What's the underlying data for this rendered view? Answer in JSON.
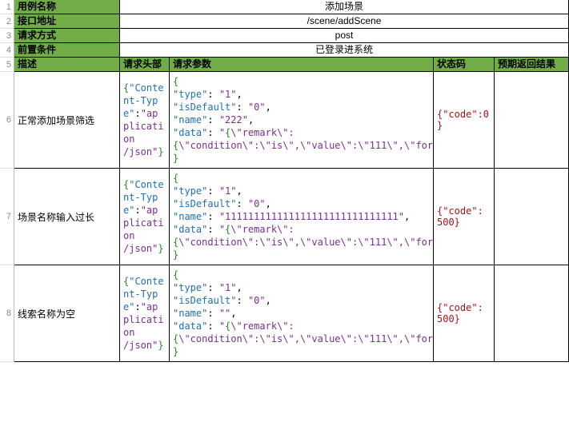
{
  "header_rows": [
    {
      "num": "1",
      "label": "用例名称",
      "value": "添加场景"
    },
    {
      "num": "2",
      "label": "接口地址",
      "value": "/scene/addScene"
    },
    {
      "num": "3",
      "label": "请求方式",
      "value": "post"
    },
    {
      "num": "4",
      "label": "前置条件",
      "value": "已登录进系统"
    }
  ],
  "col_row_num": "5",
  "columns": {
    "desc": "描述",
    "reqhdr": "请求头部",
    "reqparam": "请求参数",
    "status": "状态码",
    "expect": "预期返回结果"
  },
  "rows": [
    {
      "num": "6",
      "desc": "正常添加场景筛选",
      "header_json": "{\"Content-Type\":\"application/json\"}",
      "param_lines": [
        "{",
        "  \"type\": \"1\",",
        "  \"isDefault\": \"0\",",
        "  \"name\": \"222\",",
        "  \"data\": \"{\\\"remark\\\":{\\\"condition\\\":\\\"is\\\",\\\"value\\\":\\\"111\\\",\\\"formType\\\":\\\"text\\\",\\\"name\\\":\\\"remark\\\"}}\"",
        "}"
      ],
      "status": "{\"code\":0}"
    },
    {
      "num": "7",
      "desc": "场景名称输入过长",
      "header_json": "{\"Content-Type\":\"application/json\"}",
      "param_lines": [
        "{",
        "  \"type\": \"1\",",
        "  \"isDefault\": \"0\",",
        "  \"name\": \"111111111111111111111111111111\",",
        "  \"data\": \"{\\\"remark\\\":{\\\"condition\\\":\\\"is\\\",\\\"value\\\":\\\"111\\\",\\\"formType\\\":\\\"text\\\",\\\"name\\\":\\\"remark\\\"}}\"",
        "}"
      ],
      "status": "{\"code\":500}"
    },
    {
      "num": "8",
      "desc": "线索名称为空",
      "header_json": "{\"Content-Type\":\"application/json\"}",
      "param_lines": [
        "{",
        "  \"type\": \"1\",",
        "  \"isDefault\": \"0\",",
        "  \"name\": \"\",",
        "  \"data\": \"{\\\"remark\\\":{\\\"condition\\\":\\\"is\\\",\\\"value\\\":\\\"111\\\",\\\"formType\\\":\\\"text\\\",\\\"name\\\":\\\"remark\\\"}}\"",
        "}"
      ],
      "status": "{\"code\":500}"
    }
  ]
}
